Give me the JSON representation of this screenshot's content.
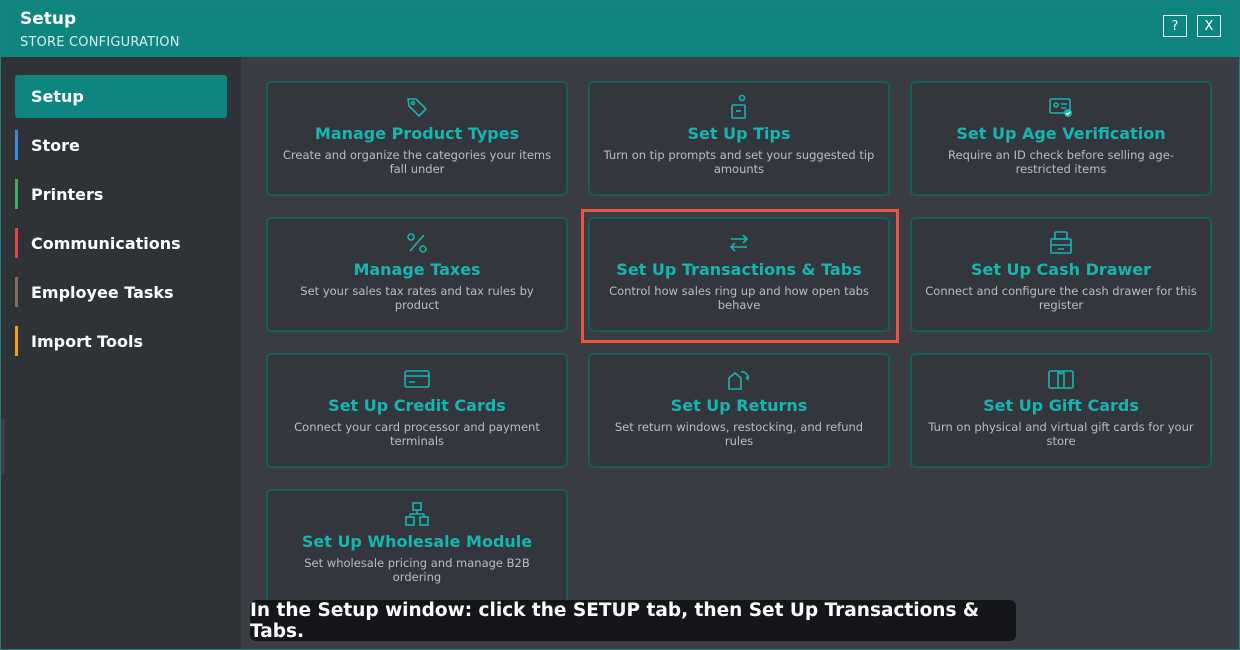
{
  "window": {
    "title": "Setup",
    "subtitle": "STORE CONFIGURATION",
    "help_label": "?",
    "close_label": "X"
  },
  "sidebar": {
    "items": [
      {
        "label": "Setup",
        "active": true
      },
      {
        "label": "Store",
        "color": "#3a8dde"
      },
      {
        "label": "Printers",
        "color": "#3fae5a"
      },
      {
        "label": "Communications",
        "color": "#e04848"
      },
      {
        "label": "Employee Tasks",
        "color": "#8a6a5a"
      },
      {
        "label": "Import Tools",
        "color": "#f0a020"
      }
    ]
  },
  "tiles": [
    {
      "icon": "tag-icon",
      "title": "Manage Product Types",
      "desc": "Create and organize the categories your items fall under"
    },
    {
      "icon": "tip-jar-icon",
      "title": "Set Up Tips",
      "desc": "Turn on tip prompts and set your suggested tip amounts"
    },
    {
      "icon": "id-check-icon",
      "title": "Set Up Age Verification",
      "desc": "Require an ID check before selling age-restricted items"
    },
    {
      "icon": "percent-icon",
      "title": "Manage Taxes",
      "desc": "Set your sales tax rates and tax rules by product"
    },
    {
      "icon": "swap-arrows-icon",
      "title": "Set Up Transactions & Tabs",
      "desc": "Control how sales ring up and how open tabs behave"
    },
    {
      "icon": "cash-drawer-icon",
      "title": "Set Up Cash Drawer",
      "desc": "Connect and configure the cash drawer for this register"
    },
    {
      "icon": "credit-card-icon",
      "title": "Set Up Credit Cards",
      "desc": "Connect your card processor and payment terminals"
    },
    {
      "icon": "return-box-icon",
      "title": "Set Up Returns",
      "desc": "Set return windows, restocking, and refund rules"
    },
    {
      "icon": "gift-card-icon",
      "title": "Set Up Gift Cards",
      "desc": "Turn on physical and virtual gift cards for your store"
    },
    {
      "icon": "boxes-icon",
      "title": "Set Up Wholesale Module",
      "desc": "Set wholesale pricing and manage B2B ordering"
    }
  ],
  "caption": "In the Setup window: click the SETUP tab, then Set Up Transactions & Tabs.",
  "colors": {
    "accent": "#0f8580",
    "tile_title": "#16b6b0",
    "highlight": "#e9573f"
  }
}
